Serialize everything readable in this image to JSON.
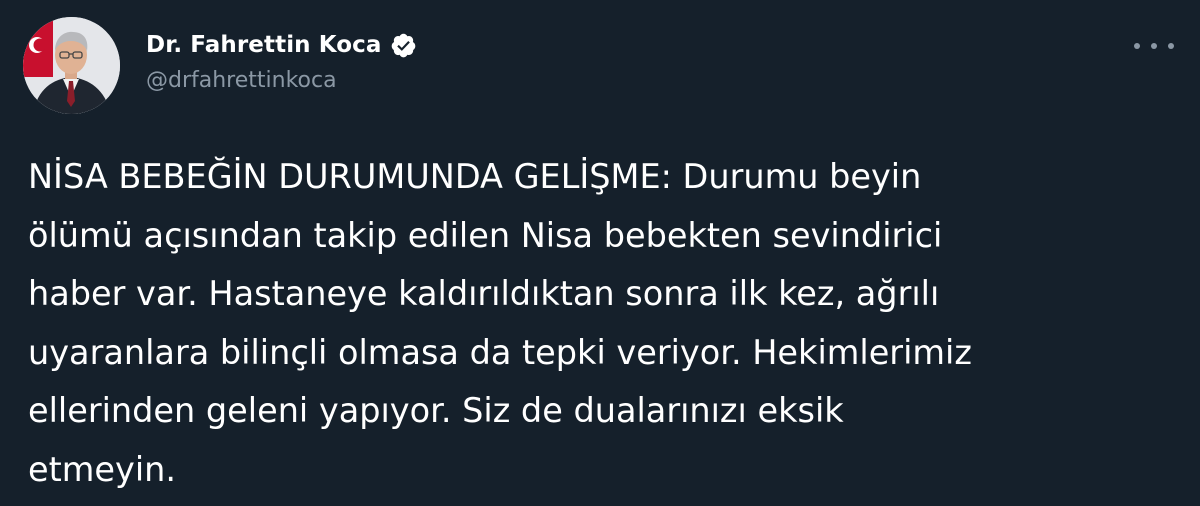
{
  "author": {
    "display_name": "Dr. Fahrettin Koca",
    "handle": "@drfahrettinkoca",
    "verified": true
  },
  "colors": {
    "background": "#15202b",
    "text": "#ffffff",
    "secondary_text": "#8b98a5",
    "verified_badge": "#ffffff"
  },
  "icons": {
    "verified": "verified-badge-icon",
    "more": "more-horizontal-icon"
  },
  "tweet": {
    "text": "NİSA BEBEĞİN DURUMUNDA GELİŞME: Durumu beyin\nölümü açısından takip edilen Nisa bebekten sevindirici\nhaber var. Hastaneye kaldırıldıktan sonra ilk kez, ağrılı\nuyaranlara bilinçli olmasa da tepki veriyor. Hekimlerimiz\nellerinden geleni yapıyor. Siz de dualarınızı eksik\netmeyin."
  }
}
